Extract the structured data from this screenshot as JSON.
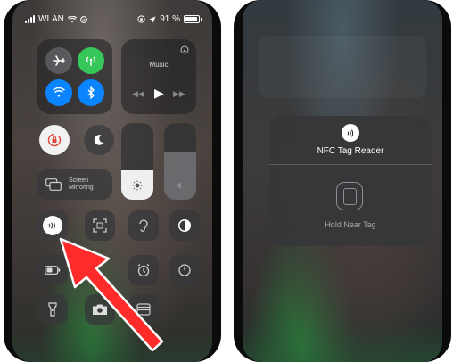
{
  "status_bar": {
    "carrier": "WLAN",
    "battery_percent": "91 %"
  },
  "control_center": {
    "music": {
      "label": "Music"
    },
    "screen_mirroring": {
      "label": "Screen Mirroring"
    },
    "highlight_color": "#ff2a2a"
  },
  "nfc_popup": {
    "title": "NFC Tag Reader",
    "hint": "Hold Near Tag"
  }
}
